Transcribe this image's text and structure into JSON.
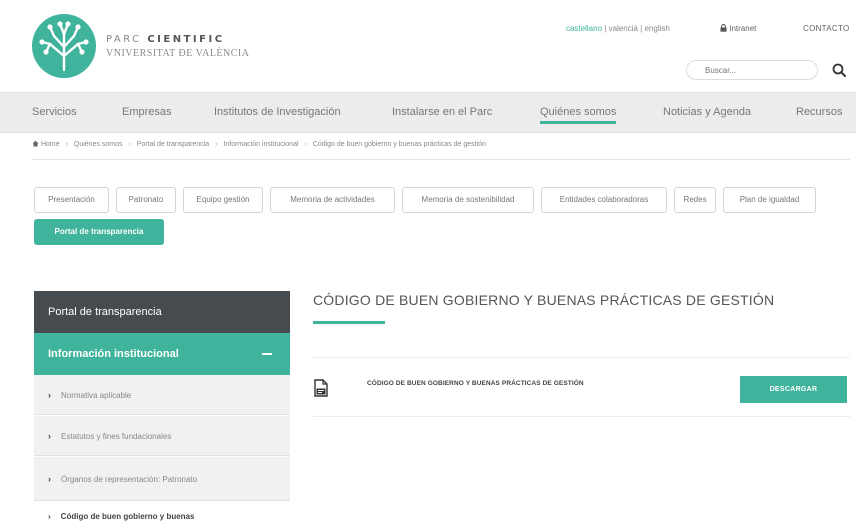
{
  "header": {
    "logo": {
      "line1_light": "PARC ",
      "line1_bold": "CIENTIFIC",
      "line2": "VNIVERSITAT ĐE VALÈNCIA"
    },
    "languages": [
      {
        "label": "castellano",
        "active": true
      },
      {
        "label": "valencià",
        "active": false
      },
      {
        "label": "english",
        "active": false
      }
    ],
    "intranet_label": "Intranet",
    "contact_label": "CONTACTO",
    "search": {
      "placeholder": "Buscar..."
    }
  },
  "main_nav": {
    "items": [
      {
        "label": "Servicios",
        "active": false
      },
      {
        "label": "Empresas",
        "active": false
      },
      {
        "label": "Institutos de Investigación",
        "active": false
      },
      {
        "label": "Instalarse en el Parc",
        "active": false
      },
      {
        "label": "Quiénes somos",
        "active": true
      },
      {
        "label": "Noticias y Agenda",
        "active": false
      },
      {
        "label": "Recursos",
        "active": false
      }
    ]
  },
  "breadcrumb": {
    "items": [
      "Home",
      "Quiénes somos",
      "Portal de transparencia",
      "Información institucional",
      "Código de buen gobierno y buenas prácticas de gestión"
    ]
  },
  "sub_tabs": [
    {
      "label": "Presentación",
      "active": false
    },
    {
      "label": "Patronato",
      "active": false
    },
    {
      "label": "Equipo gestión",
      "active": false
    },
    {
      "label": "Memoria de actividades",
      "active": false
    },
    {
      "label": "Memoria de sostenibilidad",
      "active": false
    },
    {
      "label": "Entidades colaboradoras",
      "active": false
    },
    {
      "label": "Redes",
      "active": false
    },
    {
      "label": "Plan de igualdad",
      "active": false
    },
    {
      "label": "Portal de transparencia",
      "active": true
    }
  ],
  "sidebar": {
    "heading": "Portal de transparencia",
    "active_section": "Información institucional",
    "items": [
      "Normativa aplicable",
      "Estatutos y fines fundacionales",
      "Órganos de representación: Patronato"
    ],
    "current_item": "Código de buen gobierno y buenas"
  },
  "content": {
    "title": "CÓDIGO DE BUEN GOBIERNO Y BUENAS PRÁCTICAS DE GESTIÓN",
    "document": {
      "label": "CÓDIGO DE BUEN GOBIERNO Y BUENAS PRÁCTICAS DE GESTIÓN",
      "button_label": "DESCARGAR"
    }
  },
  "colors": {
    "accent": "#3fb39b",
    "sidebar_dark": "#464b4f",
    "nav_bg": "#ececec"
  },
  "icons": [
    "logo-tree-icon",
    "lock-icon",
    "search-icon",
    "home-icon",
    "chevron-right-icon",
    "minus-icon",
    "document-icon"
  ]
}
